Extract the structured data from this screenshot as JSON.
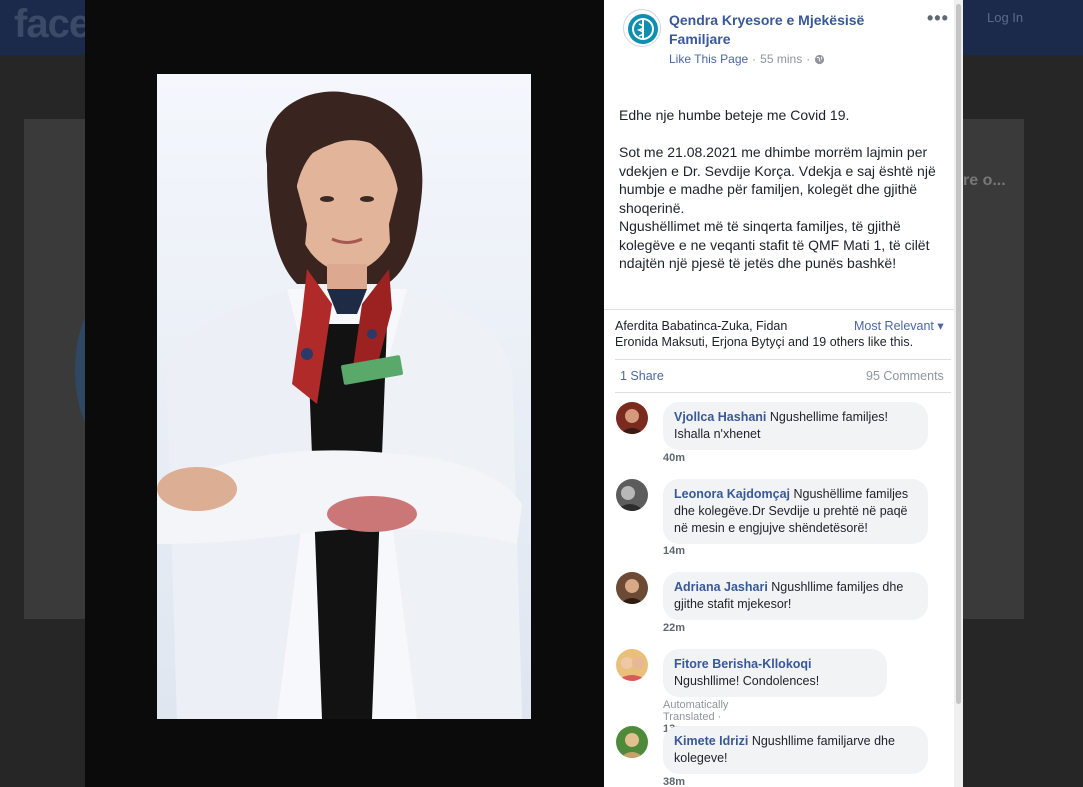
{
  "background": {
    "logo": "face",
    "login": "Log In",
    "card_text": "re o..."
  },
  "post": {
    "page_name": "Qendra Kryesore e Mjekësisë Familjare",
    "like_page": "Like This Page",
    "separator": "·",
    "time": "55 mins",
    "more": "•••",
    "body": "Edhe nje humbe beteje me Covid 19.\n\nSot me 21.08.2021 me dhimbe morrëm lajmin per vdekjen e Dr. Sevdije Korça. Vdekja e saj është një humbje e madhe për familjen, kolegët dhe gjithë shoqerinë.\nNgushëllimet më të sinqerta familjes, të gjithë kolegëve e ne veqanti stafit të QMF Mati 1, të cilët ndajtën një pjesë të jetës dhe punës bashkë!",
    "likers_line1": "Aferdita Babatinca-Zuka, Fidan",
    "likers_line2": "Eronida Maksuti, Erjona Bytyçi and 19 others like this.",
    "most_relevant": "Most Relevant ▾",
    "share": "1 Share",
    "comments_count": "95 Comments"
  },
  "comments": [
    {
      "author": "Vjollca Hashani",
      "text": "Ngushellime familjes! Ishalla n'xhenet",
      "time": "40m",
      "translated": ""
    },
    {
      "author": "Leonora Kajdomçaj",
      "text": "Ngushëllime familjes dhe kolegëve.Dr Sevdije u prehtë në paqë në mesin e engjujve shëndetësorë!",
      "time": "14m",
      "translated": ""
    },
    {
      "author": "Adriana Jashari",
      "text": "Ngushllime familjes dhe gjithe stafit mjekesor!",
      "time": "22m",
      "translated": ""
    },
    {
      "author": "Fitore Berisha-Kllokoqi",
      "text": "Ngushllime! Condolences!",
      "time": "13m",
      "translated": "Automatically Translated"
    },
    {
      "author": "Kimete Idrizi",
      "text": "Ngushllime familjarve dhe kolegeve!",
      "time": "38m",
      "translated": ""
    }
  ],
  "colors": {
    "link": "#385898",
    "muted": "#90949c",
    "bubble": "#f2f3f5"
  }
}
